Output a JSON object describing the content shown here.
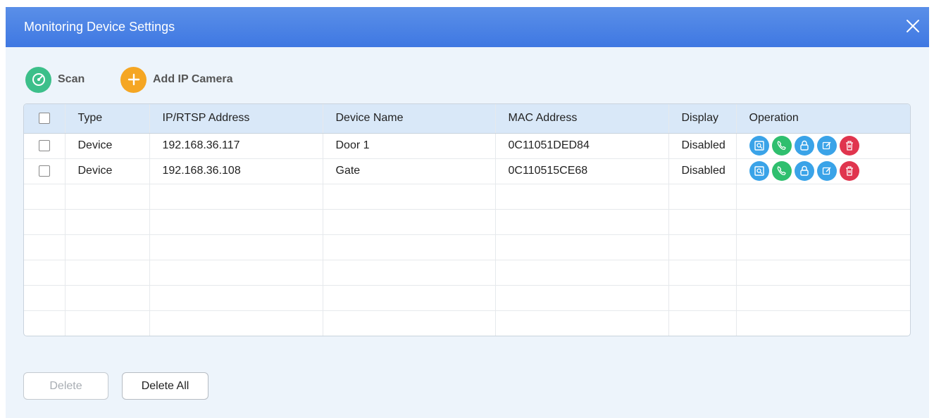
{
  "window": {
    "title": "Monitoring Device Settings"
  },
  "toolbar": {
    "scan_label": "Scan",
    "add_label": "Add IP Camera",
    "colors": {
      "scan": "#3cbf8a",
      "add": "#f5a623"
    }
  },
  "table": {
    "columns": [
      "Type",
      "IP/RTSP Address",
      "Device Name",
      "MAC Address",
      "Display",
      "Operation"
    ],
    "rows": [
      {
        "type": "Device",
        "ip": "192.168.36.117",
        "name": "Door 1",
        "mac": "0C11051DED84",
        "display": "Disabled"
      },
      {
        "type": "Device",
        "ip": "192.168.36.108",
        "name": "Gate",
        "mac": "0C110515CE68",
        "display": "Disabled"
      }
    ],
    "operation_icons": [
      "preview-icon",
      "call-icon",
      "unlock-icon",
      "edit-icon",
      "delete-icon"
    ],
    "operation_colors": [
      "#3aa3e8",
      "#2fbf6e",
      "#3aa3e8",
      "#3aa3e8",
      "#e0354e"
    ]
  },
  "footer": {
    "delete_label": "Delete",
    "delete_all_label": "Delete All"
  },
  "colors": {
    "title_bar": "#4a82e4",
    "header_row": "#d9e8f8",
    "dialog_bg": "#edf4fb"
  }
}
